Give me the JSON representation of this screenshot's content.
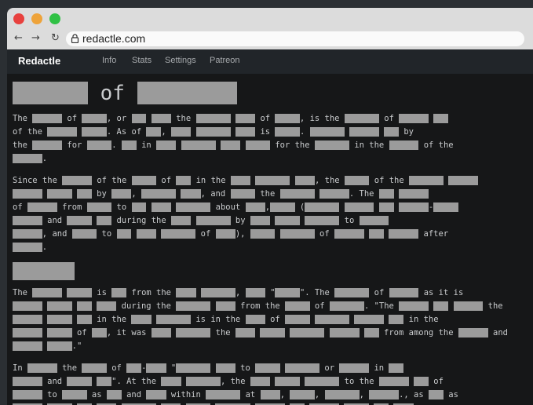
{
  "browser": {
    "url": "redactle.com",
    "traffic_lights": [
      "#e8413e",
      "#eea33a",
      "#30c145"
    ]
  },
  "nav": {
    "brand": "Redactle",
    "links": [
      "Info",
      "Stats",
      "Settings",
      "Patreon"
    ]
  },
  "article": {
    "title": "[] of []",
    "lines": [
      "The [] of [], or [] [] the [] [] of [], is the [] of [] []",
      "of the [] []. As of [], [] [] [] is []. [] [] [] by",
      "the [] for []. [] in [] [] [] [] for the [] in the [] of the",
      "[].",
      "Since the [] of the [] of [] in the [] [] [], the [] of the [] []",
      "[] [] [] by [], [] [], and [] the [] []. The [] []",
      "of [] from [] to [] [] [] about [],[] ([] [] [] []-[]",
      "[] and [] [] during the [] [] by [] [] [] to []",
      "[], and [] to [] [] [] of []), [] [] of [] [] [] after",
      "[].",
      "The [] [] is [] from the [] [], [] \"[]\". The [] of [] as it is",
      "[] [] [] [] during the [] [] from the [] of []. \"The [] [] [] the",
      "[] [] [] in the [] [] is in the [] of [] [] [] [] in the",
      "[] [] of [], it was [] [] the [] [] [] [] [] from among the [] and",
      "[] [].\"",
      "In [] the [] of []-[] \"[] [] to [] [] or [] in []",
      "[] and [] []\". At the [] [], the [] [] [] to the [] [] of",
      "[] to [] as [] and [] within [] at [], [], [], []., as [] as",
      "[] [] [] [] [] [] [] [] [] [] [] [] [] []"
    ]
  }
}
